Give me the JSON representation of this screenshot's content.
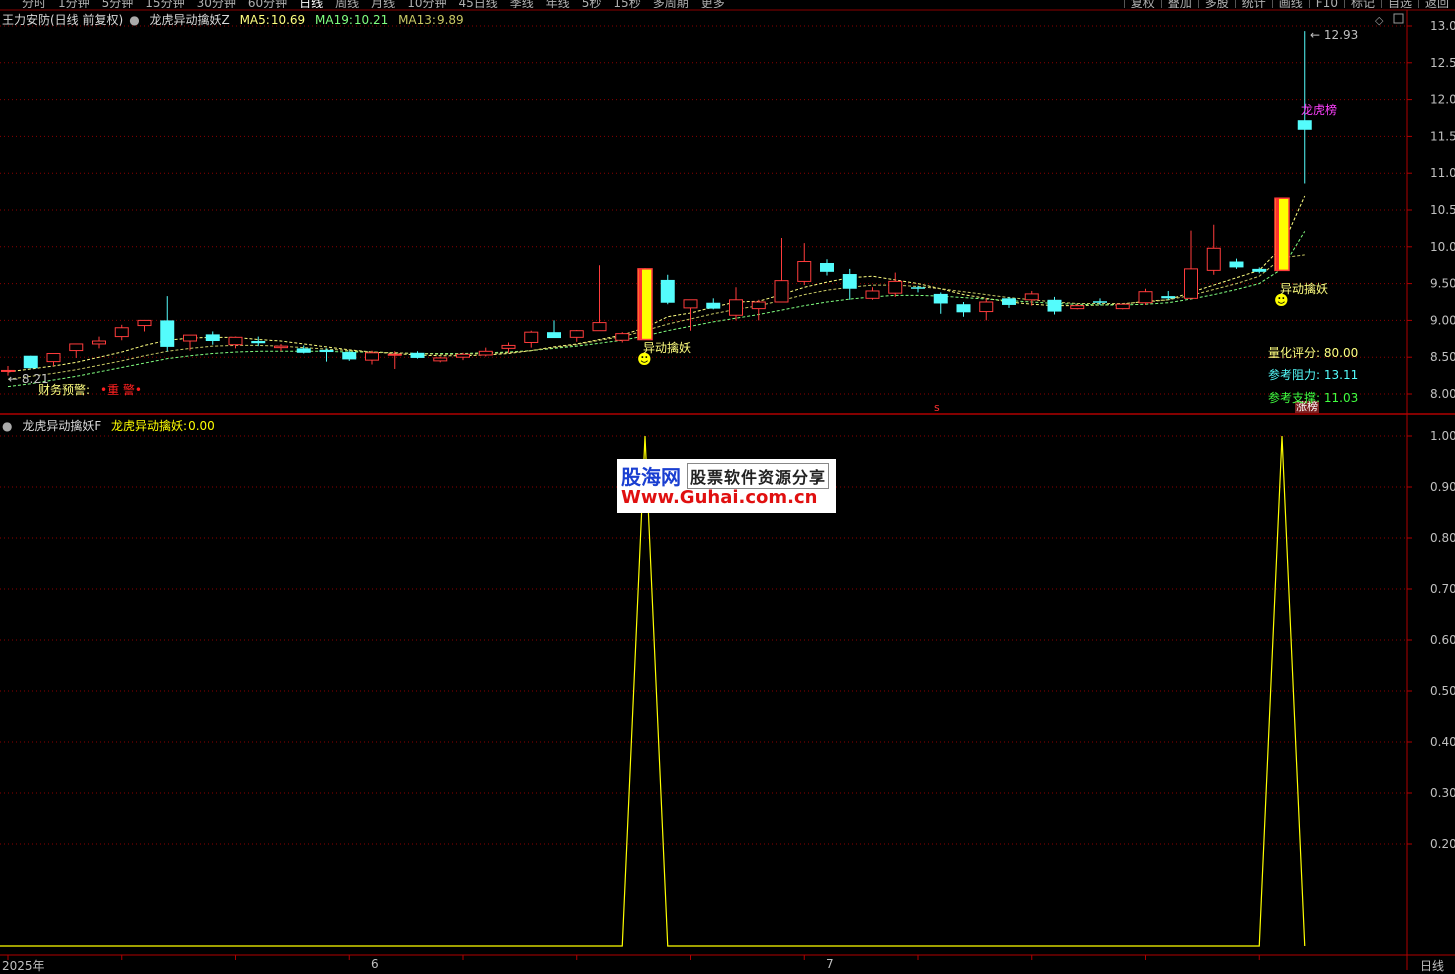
{
  "toolbar": {
    "periods": [
      "分时",
      "1分钟",
      "5分钟",
      "15分钟",
      "30分钟",
      "60分钟",
      "日线",
      "周线",
      "月线",
      "10分钟",
      "45日线",
      "季线",
      "年线",
      "5秒",
      "15秒",
      "多周期",
      "更多"
    ],
    "active_period": "日线",
    "tools": [
      "复权",
      "叠加",
      "多股",
      "统计",
      "画线",
      "F10",
      "标记",
      "自选",
      "返回"
    ]
  },
  "main_header": {
    "stock": "王力安防(日线 前复权)",
    "indicator": "龙虎异动擒妖Z",
    "ma5_label": "MA5:",
    "ma5_value": "10.69",
    "ma19_label": "MA19:",
    "ma19_value": "10.21",
    "ma13_label": "MA13:",
    "ma13_value": "9.89"
  },
  "sub_header": {
    "indicator": "龙虎异动擒妖F",
    "series_label": "龙虎异动擒妖:",
    "series_value": "0.00"
  },
  "annotations": {
    "low_price": "8.21",
    "high_price": "12.93",
    "finance_warning_label": "财务预警:",
    "finance_warning_value": "•重 警•",
    "signal_label": "异动擒妖",
    "dragon_label": "龙虎榜",
    "zhang_label": "涨榜",
    "s_marker": "s",
    "quant_score_label": "量化评分:",
    "quant_score_value": "80.00",
    "resistance_label": "参考阻力:",
    "resistance_value": "13.11",
    "support_label": "参考支撑:",
    "support_value": "11.03"
  },
  "x_axis": {
    "labels": [
      "2025年",
      "6",
      "7"
    ],
    "period": "日线"
  },
  "watermark": {
    "brand": "股海网",
    "tagline": "股票软件资源分享",
    "url": "Www.Guhai.com.cn"
  },
  "colors": {
    "up": "#ff3c3c",
    "down": "#54fcfc",
    "ma5": "#ffff80",
    "ma19": "#c8c864",
    "ma13": "#80ff80",
    "signal": "#ffff00",
    "grid": "#8b0000",
    "axis": "#c0c0c0"
  },
  "chart_data": [
    {
      "type": "candlestick",
      "title": "龙虎异动擒妖Z",
      "ylim": [
        7.8,
        13.05
      ],
      "yticks": [
        8.0,
        8.5,
        9.0,
        9.5,
        10.0,
        10.5,
        11.0,
        11.5,
        12.0,
        12.5,
        13.0
      ],
      "ohlc": [
        [
          8.32,
          8.38,
          8.25,
          8.32
        ],
        [
          8.52,
          8.52,
          8.4,
          8.35
        ],
        [
          8.44,
          8.55,
          8.38,
          8.55
        ],
        [
          8.59,
          8.66,
          8.49,
          8.68
        ],
        [
          8.68,
          8.78,
          8.62,
          8.72
        ],
        [
          8.78,
          8.94,
          8.73,
          8.9
        ],
        [
          8.93,
          9.0,
          8.85,
          9.0
        ],
        [
          9.0,
          9.33,
          8.58,
          8.64
        ],
        [
          8.72,
          8.8,
          8.59,
          8.8
        ],
        [
          8.81,
          8.85,
          8.67,
          8.72
        ],
        [
          8.67,
          8.78,
          8.62,
          8.77
        ],
        [
          8.72,
          8.78,
          8.65,
          8.69
        ],
        [
          8.63,
          8.68,
          8.58,
          8.65
        ],
        [
          8.62,
          8.66,
          8.55,
          8.56
        ],
        [
          8.6,
          8.62,
          8.44,
          8.57
        ],
        [
          8.57,
          8.59,
          8.45,
          8.47
        ],
        [
          8.46,
          8.59,
          8.4,
          8.56
        ],
        [
          8.53,
          8.58,
          8.34,
          8.54
        ],
        [
          8.56,
          8.58,
          8.48,
          8.49
        ],
        [
          8.45,
          8.5,
          8.43,
          8.49
        ],
        [
          8.5,
          8.56,
          8.46,
          8.54
        ],
        [
          8.53,
          8.63,
          8.51,
          8.58
        ],
        [
          8.62,
          8.7,
          8.56,
          8.66
        ],
        [
          8.7,
          8.86,
          8.63,
          8.84
        ],
        [
          8.84,
          9.0,
          8.78,
          8.76
        ],
        [
          8.77,
          8.87,
          8.71,
          8.86
        ],
        [
          8.86,
          9.75,
          8.86,
          8.97
        ],
        [
          8.73,
          8.84,
          8.7,
          8.82
        ],
        [
          8.74,
          9.71,
          8.74,
          9.7
        ],
        [
          9.55,
          9.62,
          9.22,
          9.24
        ],
        [
          9.17,
          9.28,
          8.86,
          9.28
        ],
        [
          9.24,
          9.3,
          9.15,
          9.16
        ],
        [
          9.07,
          9.45,
          9.0,
          9.28
        ],
        [
          9.16,
          9.28,
          9.0,
          9.25
        ],
        [
          9.25,
          10.12,
          9.25,
          9.54
        ],
        [
          9.53,
          10.05,
          9.48,
          9.8
        ],
        [
          9.78,
          9.83,
          9.61,
          9.66
        ],
        [
          9.63,
          9.7,
          9.28,
          9.43
        ],
        [
          9.3,
          9.45,
          9.28,
          9.4
        ],
        [
          9.37,
          9.65,
          9.32,
          9.53
        ],
        [
          9.45,
          9.47,
          9.38,
          9.43
        ],
        [
          9.36,
          9.38,
          9.09,
          9.23
        ],
        [
          9.22,
          9.25,
          9.05,
          9.11
        ],
        [
          9.12,
          9.3,
          9.0,
          9.25
        ],
        [
          9.3,
          9.32,
          9.17,
          9.21
        ],
        [
          9.28,
          9.4,
          9.2,
          9.36
        ],
        [
          9.28,
          9.32,
          9.08,
          9.12
        ],
        [
          9.16,
          9.22,
          9.15,
          9.2
        ],
        [
          9.26,
          9.3,
          9.21,
          9.24
        ],
        [
          9.16,
          9.22,
          9.15,
          9.22
        ],
        [
          9.24,
          9.43,
          9.21,
          9.39
        ],
        [
          9.33,
          9.4,
          9.28,
          9.3
        ],
        [
          9.3,
          10.22,
          9.3,
          9.7
        ],
        [
          9.68,
          10.3,
          9.62,
          9.98
        ],
        [
          9.8,
          9.84,
          9.7,
          9.72
        ],
        [
          9.7,
          9.72,
          9.64,
          9.66
        ],
        [
          9.68,
          10.66,
          9.68,
          10.66
        ],
        [
          11.72,
          12.93,
          10.86,
          11.59
        ]
      ],
      "series": [
        {
          "name": "MA5",
          "values": [
            8.3,
            8.34,
            8.38,
            8.43,
            8.5,
            8.57,
            8.66,
            8.73,
            8.76,
            8.77,
            8.77,
            8.74,
            8.72,
            8.68,
            8.64,
            8.6,
            8.57,
            8.55,
            8.53,
            8.52,
            8.52,
            8.53,
            8.55,
            8.59,
            8.64,
            8.68,
            8.74,
            8.8,
            8.9,
            9.05,
            9.1,
            9.18,
            9.25,
            9.26,
            9.35,
            9.45,
            9.52,
            9.58,
            9.6,
            9.55,
            9.5,
            9.43,
            9.35,
            9.3,
            9.25,
            9.22,
            9.2,
            9.2,
            9.21,
            9.22,
            9.26,
            9.28,
            9.38,
            9.48,
            9.58,
            9.68,
            10.0,
            10.69
          ]
        },
        {
          "name": "MA19",
          "values": [
            8.1,
            8.14,
            8.19,
            8.24,
            8.3,
            8.36,
            8.42,
            8.48,
            8.52,
            8.55,
            8.57,
            8.58,
            8.58,
            8.58,
            8.58,
            8.57,
            8.57,
            8.56,
            8.55,
            8.55,
            8.55,
            8.56,
            8.57,
            8.59,
            8.62,
            8.65,
            8.69,
            8.73,
            8.79,
            8.86,
            8.92,
            8.98,
            9.03,
            9.08,
            9.14,
            9.2,
            9.25,
            9.29,
            9.32,
            9.34,
            9.34,
            9.33,
            9.31,
            9.29,
            9.27,
            9.25,
            9.23,
            9.22,
            9.21,
            9.21,
            9.22,
            9.24,
            9.29,
            9.35,
            9.42,
            9.5,
            9.7,
            10.21
          ]
        },
        {
          "name": "MA13",
          "values": [
            8.2,
            8.24,
            8.28,
            8.33,
            8.39,
            8.45,
            8.52,
            8.58,
            8.62,
            8.65,
            8.66,
            8.66,
            8.65,
            8.63,
            8.61,
            8.59,
            8.57,
            8.56,
            8.55,
            8.54,
            8.54,
            8.55,
            8.56,
            8.59,
            8.63,
            8.67,
            8.73,
            8.78,
            8.86,
            8.95,
            9.02,
            9.09,
            9.15,
            9.2,
            9.27,
            9.35,
            9.41,
            9.45,
            9.48,
            9.48,
            9.46,
            9.43,
            9.39,
            9.35,
            9.31,
            9.28,
            9.25,
            9.23,
            9.23,
            9.23,
            9.25,
            9.28,
            9.34,
            9.42,
            9.5,
            9.6,
            9.85,
            9.89
          ]
        }
      ],
      "signals": [
        {
          "index": 28,
          "label": "异动擒妖"
        },
        {
          "index": 56,
          "label": "异动擒妖"
        }
      ]
    },
    {
      "type": "line",
      "title": "龙虎异动擒妖F",
      "ylim": [
        0,
        1.0
      ],
      "yticks": [
        0.2,
        0.3,
        0.4,
        0.5,
        0.6,
        0.7,
        0.8,
        0.9,
        1.0
      ],
      "series": [
        {
          "name": "龙虎异动擒妖",
          "values": [
            0,
            0,
            0,
            0,
            0,
            0,
            0,
            0,
            0,
            0,
            0,
            0,
            0,
            0,
            0,
            0,
            0,
            0,
            0,
            0,
            0,
            0,
            0,
            0,
            0,
            0,
            0,
            0,
            1,
            0,
            0,
            0,
            0,
            0,
            0,
            0,
            0,
            0,
            0,
            0,
            0,
            0,
            0,
            0,
            0,
            0,
            0,
            0,
            0,
            0,
            0,
            0,
            0,
            0,
            0,
            0,
            1,
            0
          ]
        }
      ]
    }
  ]
}
